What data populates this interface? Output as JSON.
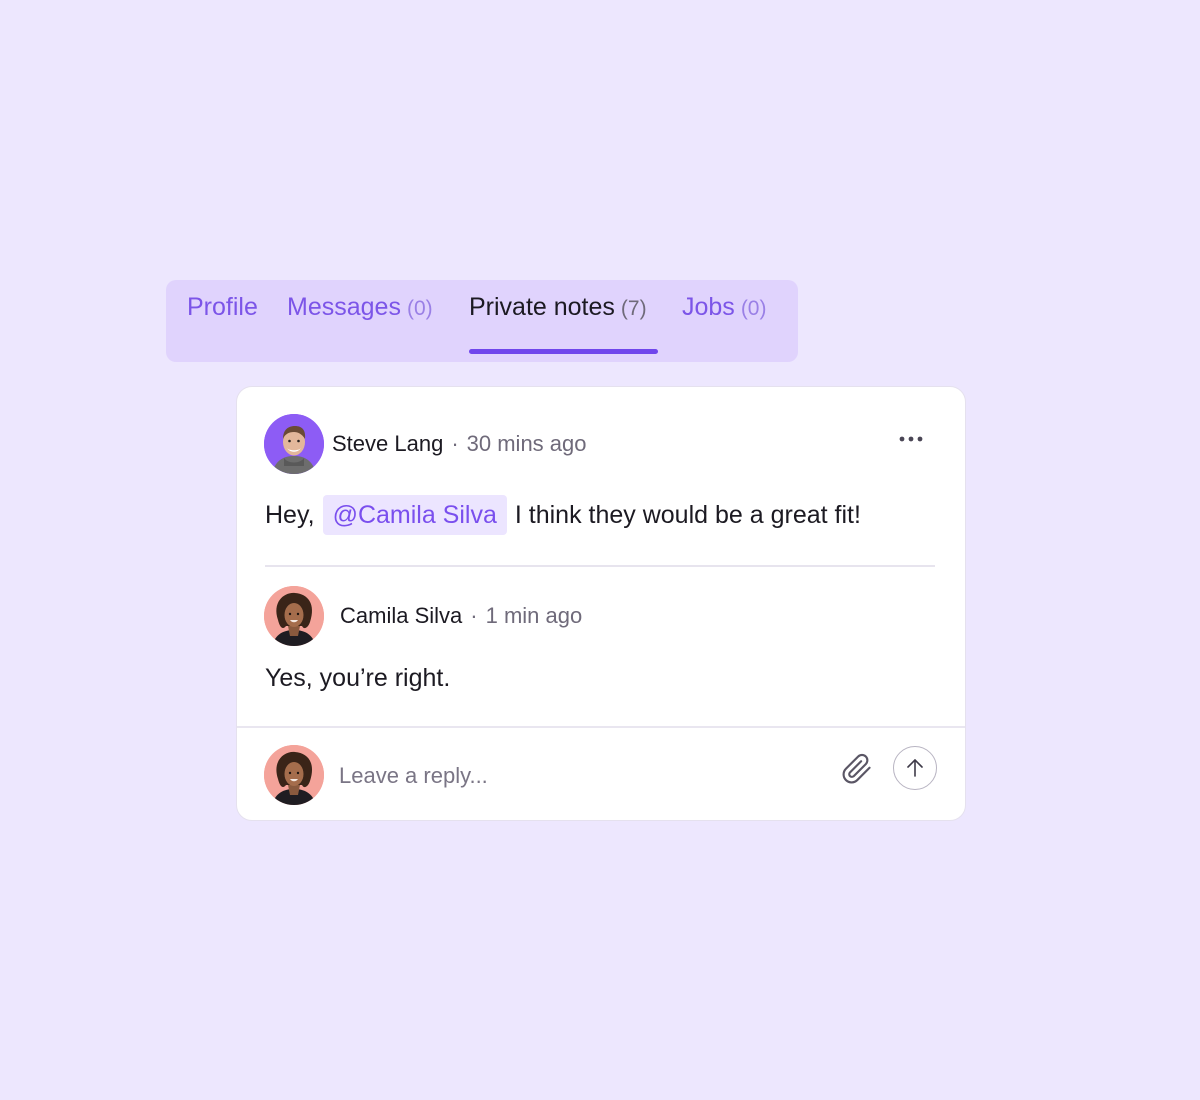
{
  "tabs": [
    {
      "label": "Profile",
      "count": ""
    },
    {
      "label": "Messages",
      "count": "(0)"
    },
    {
      "label": "Private notes",
      "count": "(7)"
    },
    {
      "label": "Jobs",
      "count": "(0)"
    }
  ],
  "active_tab": "Private notes",
  "note": {
    "author": "Steve Lang",
    "separator": "·",
    "time": "30 mins ago",
    "text_before": "Hey,",
    "mention": "@Camila Silva",
    "text_after": "I think they would be a great fit!",
    "more_icon": "more-horizontal-icon"
  },
  "reply": {
    "author": "Camila Silva",
    "separator": "·",
    "time": "1 min ago",
    "text": "Yes, you’re right."
  },
  "composer": {
    "placeholder": "Leave a reply...",
    "attach_icon": "paperclip-icon",
    "send_icon": "arrow-up-icon"
  },
  "colors": {
    "background": "#ede7fe",
    "tab_bar": "#e0d3fd",
    "accent": "#7046ec",
    "mention_bg": "#ece5ff",
    "mention_text": "#7a4fee"
  }
}
